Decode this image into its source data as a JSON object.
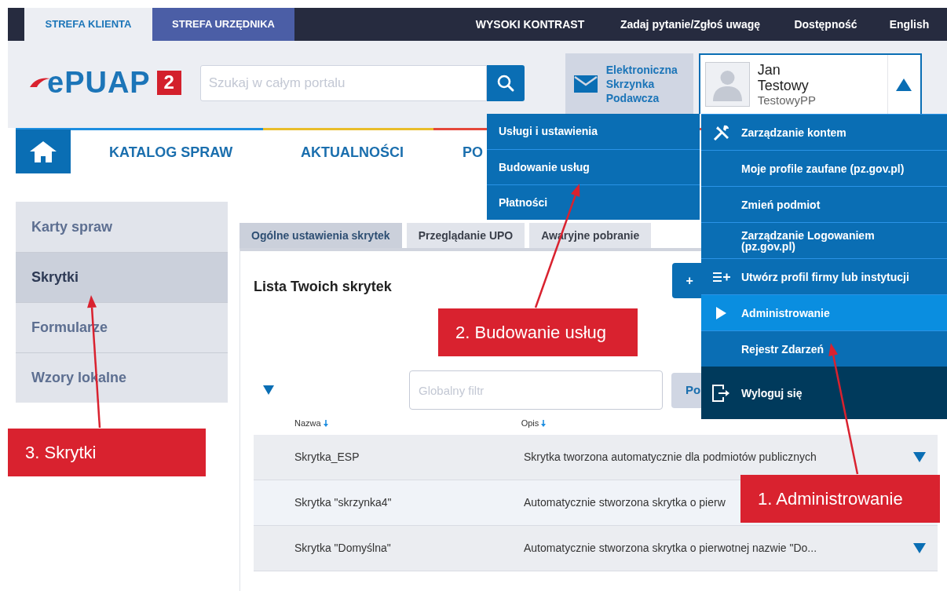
{
  "top_bar": {
    "zone_tabs": [
      {
        "label": "STREFA KLIENTA",
        "selected": true
      },
      {
        "label": "STREFA URZĘDNIKA",
        "selected": false
      }
    ],
    "links": [
      "WYSOKI KONTRAST",
      "Zadaj pytanie/Zgłoś uwagę",
      "Dostępność",
      "English"
    ]
  },
  "header": {
    "logo_text": "ePUAP",
    "logo_badge": "2",
    "search": {
      "placeholder": "Szukaj w całym portalu"
    },
    "mailbox_lines": [
      "Elektroniczna",
      "Skrzynka",
      "Podawcza"
    ],
    "user": {
      "first_name": "Jan",
      "last_name": "Testowy",
      "login": "TestowyPP",
      "menu_open": true
    }
  },
  "main_nav": [
    "KATALOG SPRAW",
    "AKTUALNOŚCI",
    "PO"
  ],
  "sidebar": {
    "items": [
      {
        "label": "Karty spraw",
        "selected": false
      },
      {
        "label": "Skrytki",
        "selected": true
      },
      {
        "label": "Formularze",
        "selected": false
      },
      {
        "label": "Wzory lokalne",
        "selected": false
      }
    ]
  },
  "content_tabs": [
    {
      "label": "Ogólne ustawienia skrytek",
      "selected": true
    },
    {
      "label": "Przeglądanie UPO",
      "selected": false
    },
    {
      "label": "Awaryjne pobranie",
      "selected": false
    }
  ],
  "list": {
    "title": "Lista Twoich skrytek",
    "add_button": "+",
    "filter": {
      "placeholder": "Globalny filtr"
    },
    "filter_button": "Po",
    "columns": [
      "Nazwa",
      "Opis"
    ],
    "rows": [
      {
        "name": "Skrytka_ESP",
        "description": "Skrytka tworzona automatycznie dla podmiotów publicznych",
        "expander": true
      },
      {
        "name": "Skrytka \"skrzynka4\"",
        "description": "Automatycznie stworzona skrytka o pierw"
      },
      {
        "name": "Skrytka \"Domyślna\"",
        "description": "Automatycznie stworzona skrytka o pierwotnej nazwie \"Do...",
        "expander": true
      }
    ]
  },
  "services_menu": {
    "items": [
      "Usługi i ustawienia",
      "Budowanie usług",
      "Płatności"
    ]
  },
  "account_menu": {
    "items": [
      {
        "label": "Zarządzanie kontem",
        "kind": "tools",
        "selected": false
      },
      {
        "label": "Moje profile zaufane (pz.gov.pl)",
        "kind": "plain",
        "selected": false
      },
      {
        "label": "Zmień podmiot",
        "kind": "plain",
        "selected": false
      },
      {
        "label": "Zarządzanie Logowaniem (pz.gov.pl)",
        "kind": "plain",
        "selected": false
      },
      {
        "label": "Utwórz profil firmy lub instytucji",
        "kind": "add",
        "selected": false
      },
      {
        "label": "Administrowanie",
        "kind": "plain",
        "selected": true
      },
      {
        "label": "Rejestr Zdarzeń",
        "kind": "plain",
        "selected": false
      },
      {
        "label": "Wyloguj się",
        "kind": "logout",
        "selected": false
      }
    ]
  },
  "callouts": [
    {
      "label": "2. Budowanie usług"
    },
    {
      "label": "3. Skrytki"
    },
    {
      "label": "1. Administrowanie"
    }
  ]
}
